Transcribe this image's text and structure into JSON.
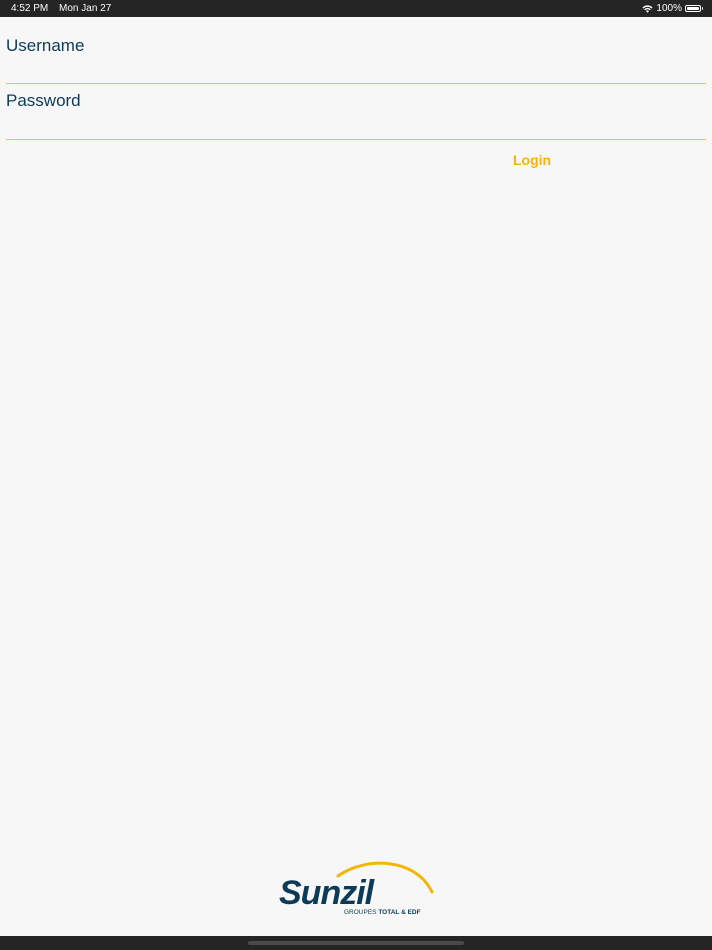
{
  "status_bar": {
    "time": "4:52 PM",
    "date": "Mon Jan 27",
    "battery": "100%"
  },
  "form": {
    "username_label": "Username",
    "username_value": "",
    "password_label": "Password",
    "password_value": "",
    "login_label": "Login"
  },
  "logo": {
    "brand": "Sunzil",
    "tagline_prefix": "GROUPES",
    "tagline_strong": "TOTAL & EDF"
  },
  "colors": {
    "background": "#f7f7f7",
    "label_text": "#0d3b57",
    "underline": "#f0c040",
    "accent": "#f2b705",
    "status_bar": "#252525",
    "logo_dark": "#0d3b57"
  }
}
